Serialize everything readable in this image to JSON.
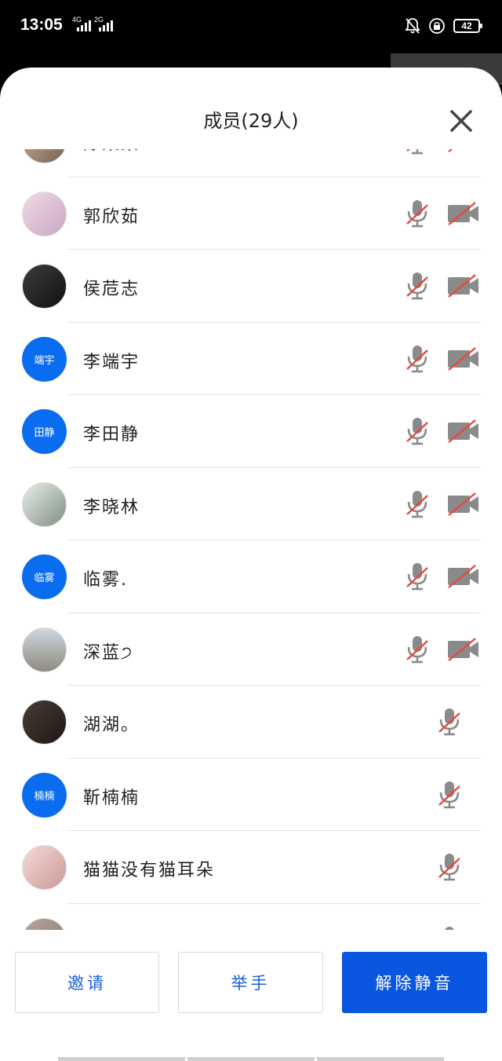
{
  "status_bar": {
    "time": "13:05",
    "signal_1_tag": "4G",
    "signal_2_tag": "2G",
    "battery": "42"
  },
  "header": {
    "title": "成员(29人)"
  },
  "members": [
    {
      "name": "陈某某",
      "avatar_type": "photo",
      "avatar_text": "",
      "mic": "muted",
      "camera": "off"
    },
    {
      "name": "郭欣茹",
      "avatar_type": "photo",
      "avatar_text": "",
      "mic": "muted",
      "camera": "off"
    },
    {
      "name": "侯苊志",
      "avatar_type": "photo",
      "avatar_text": "",
      "mic": "muted",
      "camera": "off"
    },
    {
      "name": "李端宇",
      "avatar_type": "text",
      "avatar_text": "端宇",
      "mic": "muted",
      "camera": "off"
    },
    {
      "name": "李田静",
      "avatar_type": "text",
      "avatar_text": "田静",
      "mic": "muted",
      "camera": "off"
    },
    {
      "name": "李晓林",
      "avatar_type": "photo",
      "avatar_text": "",
      "mic": "muted",
      "camera": "off"
    },
    {
      "name": "临雾.",
      "avatar_type": "text",
      "avatar_text": "临雾",
      "mic": "muted",
      "camera": "off"
    },
    {
      "name": "深蓝੭",
      "avatar_type": "photo",
      "avatar_text": "",
      "mic": "muted",
      "camera": "off"
    },
    {
      "name": "湖湖。",
      "avatar_type": "photo",
      "avatar_text": "",
      "mic": "muted",
      "camera": "none"
    },
    {
      "name": "靳楠楠",
      "avatar_type": "text",
      "avatar_text": "楠楠",
      "mic": "muted",
      "camera": "none"
    },
    {
      "name": "猫猫没有猫耳朵",
      "avatar_type": "photo",
      "avatar_text": "",
      "mic": "muted",
      "camera": "none"
    },
    {
      "name": "",
      "avatar_type": "photo",
      "avatar_text": "",
      "mic": "muted",
      "camera": "none"
    }
  ],
  "footer": {
    "invite_label": "邀请",
    "raise_hand_label": "举手",
    "unmute_label": "解除静音"
  },
  "colors": {
    "accent": "#0a56e0",
    "avatar_blue": "#0a6df0",
    "muted_slash": "#e8473d",
    "icon_gray": "#8a8a8a"
  }
}
